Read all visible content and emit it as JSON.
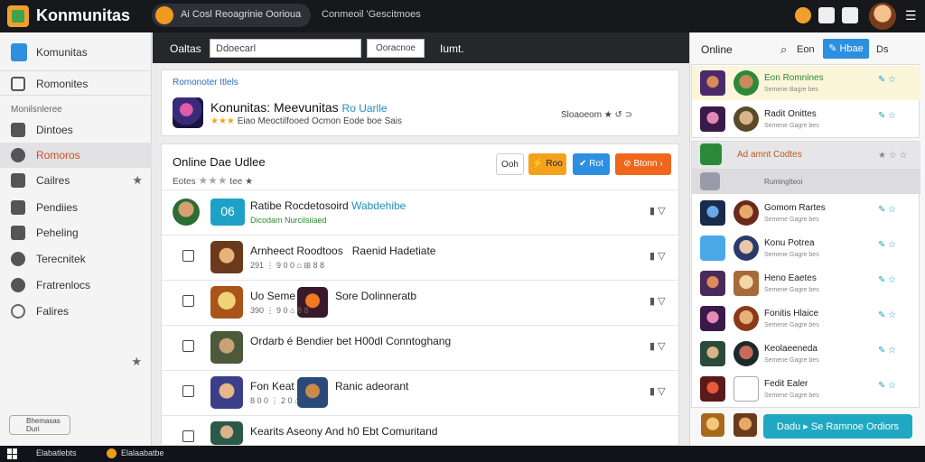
{
  "topbar": {
    "brand": "Konmunitas",
    "chip_label": "Ai Cosl Reoagrinie Oorioua",
    "link_label": "Conmeoil 'Gescitmoes",
    "icons": [
      "bolt-icon",
      "rocket-icon",
      "camera-icon"
    ],
    "avatar": "user-avatar"
  },
  "sidebar": {
    "app_label": "Komunitas",
    "items": [
      {
        "label": "Romonites",
        "icon": "home-icon",
        "star": ""
      },
      {
        "label": "Dintoes",
        "icon": "grid-icon",
        "star": ""
      },
      {
        "label": "Romoros",
        "icon": "gamepad-icon",
        "star": "",
        "active": true
      },
      {
        "label": "Cailres",
        "icon": "folder-icon",
        "star": "★"
      },
      {
        "label": "Pendiies",
        "icon": "check-icon",
        "star": ""
      },
      {
        "label": "Peheling",
        "icon": "tag-icon",
        "star": ""
      },
      {
        "label": "Terecnitek",
        "icon": "clock-icon",
        "star": ""
      },
      {
        "label": "Fratrenlocs",
        "icon": "target-icon",
        "star": ""
      },
      {
        "label": "Falires",
        "icon": "gear-icon",
        "star": ""
      }
    ],
    "section_label": "Monilsnleree",
    "extra_star": "★",
    "footer_label": "Bhemasas Duri"
  },
  "filterbar": {
    "label": "Oaltas",
    "input_value": "Ddoecarl",
    "button_label": "Ooracnoe",
    "text": "Iumt."
  },
  "hero": {
    "tag": "Romonoter Itlels",
    "title": "Konunitas: Meevunitas",
    "title_accent": "Ro Uarlle",
    "stars": "★★★",
    "sub": "Eiao  Meoctilfooed Ocmon Eode boe Sais",
    "right": "Sloaoeom ★  ↺ ⊃"
  },
  "main": {
    "title": "Online",
    "title_bold": "Dae Udlee",
    "sub_label": "Eotes",
    "sub_stars": "★★★",
    "sub_after": "tee ★",
    "buttons": {
      "outline": "Ooh",
      "yellow": "⚡ Roo",
      "blue": "✔ Rot",
      "orange": "⊘ Btonn ›"
    },
    "pinned": {
      "badge": "06",
      "title": "Ratibe Rocdetosoird",
      "title_accent": "Wabdehibe",
      "meta": "Dicodam Nurcilsiiaed"
    },
    "rows": [
      {
        "title": "Arnheect Roodtoos",
        "title2": "Raenid Hadetiate",
        "meta": "291 ⋮ 9 0 0 ⌂ ⊞ 8 8"
      },
      {
        "title": "Uo Seme",
        "title2": "Sore Dolinneratb",
        "meta": "390 ⋮ 9 0 ⌂ 8 8"
      },
      {
        "title": "Ordarb é Bendier bet H00dl Conntoghang",
        "title2": "",
        "meta": ""
      },
      {
        "title": "Fon Keat",
        "title2": "Ranic adeorant",
        "meta": "8 0 0 ⋮ 2 0 ⌂"
      },
      {
        "title": "Kearits Aseony And h0 Ebt Comuritand",
        "title2": "",
        "meta": ""
      }
    ],
    "row_icons": "▮ ▽"
  },
  "rightpanel": {
    "title": "Online",
    "small": "Eon",
    "new_button": "✎ Hbae",
    "ds": "Ds",
    "group1": [
      {
        "label": "Eon Romnines",
        "sub": "Semene Bagre bes",
        "green": true
      },
      {
        "label": "Radit Onittes",
        "sub": "Semene Gagre bes",
        "green": false
      }
    ],
    "group2_header": "Ad amnt Codtes",
    "group2_sub": "Ruminglteoi",
    "group2": [
      {
        "label": "Gomom Rartes",
        "sub": "Semene Gagre bes"
      },
      {
        "label": "Konu Potrea",
        "sub": "Semene Gagre bes"
      },
      {
        "label": "Heno Eaetes",
        "sub": "Semene Gagre bes"
      },
      {
        "label": "Fonitis Hlaice",
        "sub": "Semene Gagre bes"
      },
      {
        "label": "Keolaeeneda",
        "sub": "Semene Gagre bes"
      },
      {
        "label": "Fedit Ealer",
        "sub": "Semene Gagre bes"
      }
    ],
    "acts": "✎ ☆",
    "cta": "Dadu ▸  Se Ramnoe Ordiors"
  },
  "taskbar": {
    "item1": "Elabatlebts",
    "item2": "Elalaabatbe"
  },
  "colors": {
    "accent_blue": "#2d8fe0",
    "accent_orange": "#f0661c",
    "accent_yellow": "#f4a21c",
    "teal": "#1ea8c2",
    "dark": "#17181c"
  }
}
